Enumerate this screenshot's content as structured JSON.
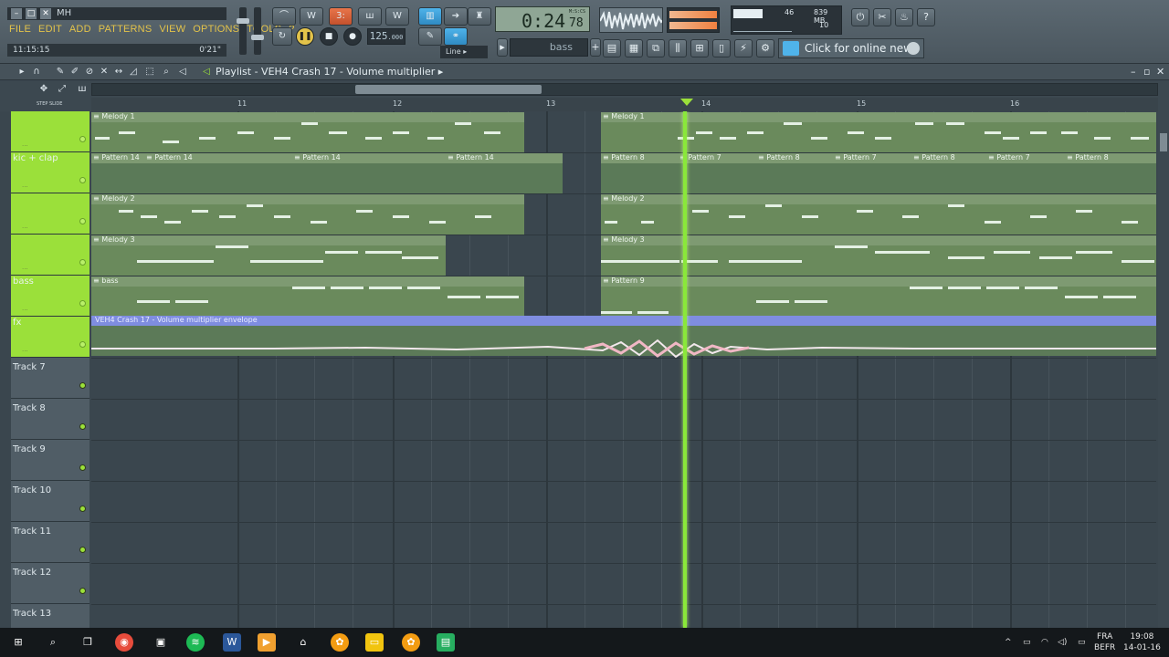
{
  "window": {
    "title": "MH",
    "menu": [
      "FILE",
      "EDIT",
      "ADD",
      "PATTERNS",
      "VIEW",
      "OPTIONS",
      "TOOLS",
      "?"
    ],
    "info_left": "11:15:15",
    "info_right": "0'21\""
  },
  "transport": {
    "tempo": "125",
    "tempo_decimal": ".000",
    "time_main": "0:24",
    "time_fraction": "78",
    "time_label": "M:S:CS",
    "snap_mode": "Line",
    "pattern": "bass"
  },
  "stats": {
    "cpu": "46",
    "memory": "839 MB",
    "polyphony": "10"
  },
  "news": {
    "label": "Click for online news"
  },
  "playlist": {
    "title": "Playlist - VEH4 Crash 17 - Volume multiplier",
    "ruler": [
      "11",
      "12",
      "13",
      "14",
      "15",
      "16"
    ],
    "snap_labels": "STEP  SLIDE",
    "playhead_position": 13.88
  },
  "tracks": [
    {
      "name": "",
      "active": true
    },
    {
      "name": "kic + clap",
      "active": true
    },
    {
      "name": "",
      "active": true
    },
    {
      "name": "",
      "active": true
    },
    {
      "name": "bass",
      "active": true
    },
    {
      "name": "fx",
      "active": true
    },
    {
      "name": "Track 7",
      "active": false
    },
    {
      "name": "Track 8",
      "active": false
    },
    {
      "name": "Track 9",
      "active": false
    },
    {
      "name": "Track 10",
      "active": false
    },
    {
      "name": "Track 11",
      "active": false
    },
    {
      "name": "Track 12",
      "active": false
    },
    {
      "name": "Track 13",
      "active": false
    }
  ],
  "clips": {
    "melody1": "Melody 1",
    "pattern14": "Pattern 14",
    "pattern8": "Pattern 8",
    "pattern7": "Pattern 7",
    "melody2": "Melody 2",
    "melody3": "Melody 3",
    "bass": "bass",
    "pattern9": "Pattern 9",
    "envelope": "VEH4 Crash 17 - Volume multiplier envelope"
  },
  "taskbar": {
    "lang_top": "FRA",
    "lang_bottom": "BEFR",
    "time": "19:08",
    "date": "14-01-16"
  }
}
